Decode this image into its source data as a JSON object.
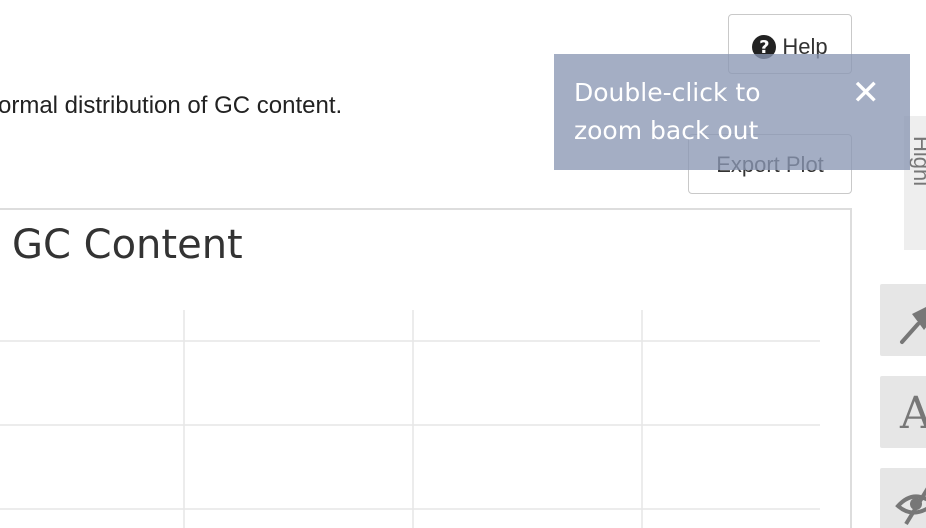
{
  "description": {
    "text": "ormal distribution of GC content."
  },
  "help_button": {
    "label": "Help",
    "icon": "question-circle-icon"
  },
  "export_button": {
    "label": "Export Plot"
  },
  "tooltip": {
    "text": "Double-click to zoom back out",
    "close_icon": "close-icon",
    "close_glyph": "✕"
  },
  "plot": {
    "title": "GC Content"
  },
  "side_panel": {
    "label": "Highl"
  },
  "toolbar": {
    "items": [
      {
        "name": "pin-icon"
      },
      {
        "name": "font-icon",
        "glyph": "A"
      },
      {
        "name": "hide-eye-icon"
      }
    ]
  },
  "colors": {
    "tooltip_bg": "#8a97b4",
    "panel_border": "#dddddd",
    "grid": "#e6e6e6",
    "toolbar_bg": "#e6e6e6"
  }
}
